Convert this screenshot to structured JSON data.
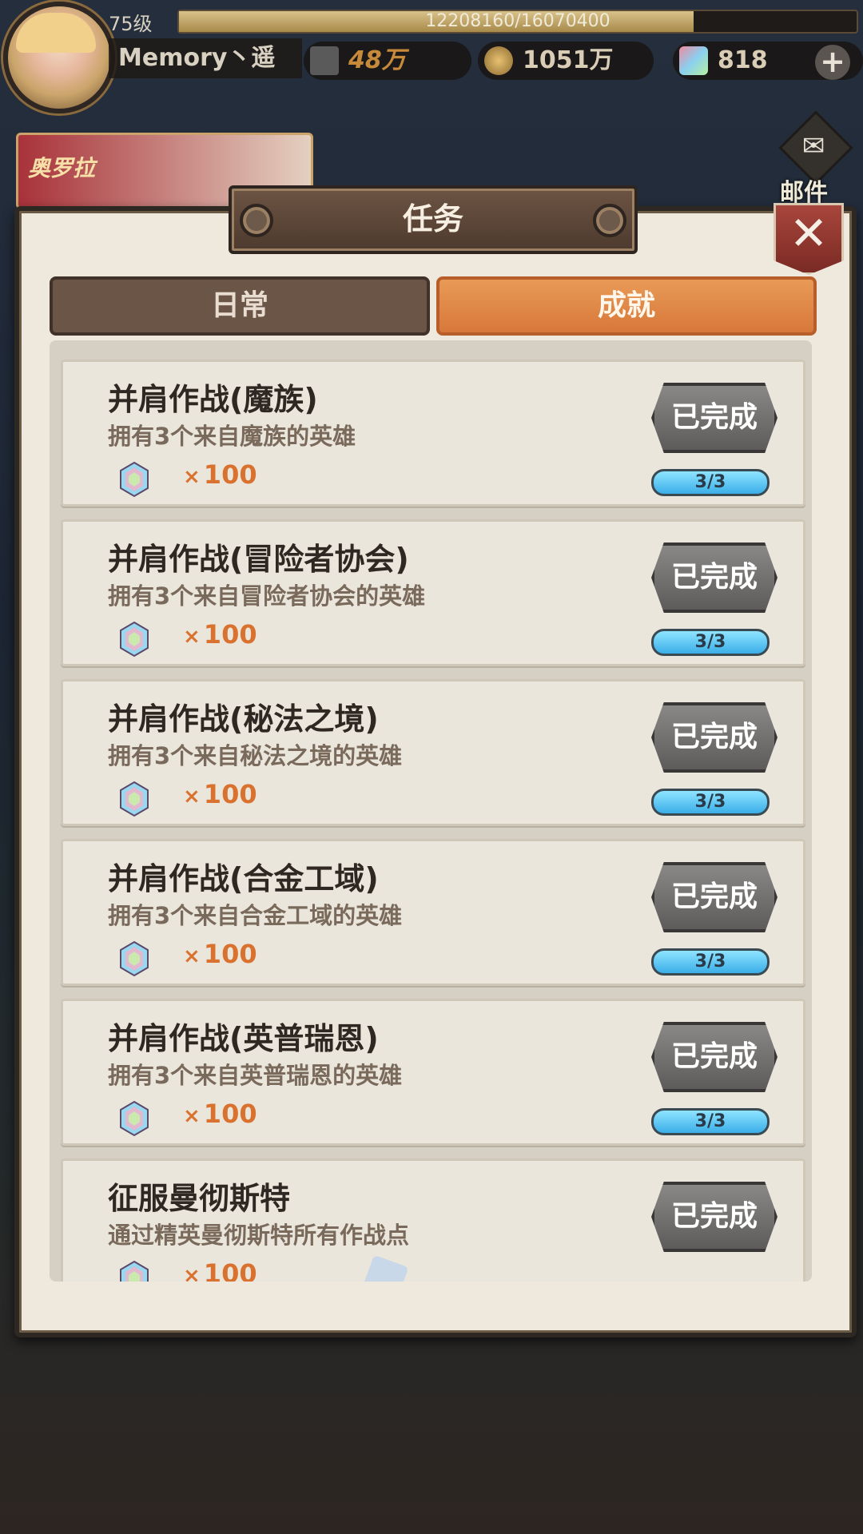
{
  "hud": {
    "level": "75级",
    "exp_text": "12208160/16070400",
    "exp_progress": 0.76,
    "player_name": "Memory丶遥",
    "power": "48万",
    "gold": "1051万",
    "gems": "818",
    "plus": "+"
  },
  "mail": {
    "label": "邮件",
    "icon": "envelope-icon"
  },
  "event_banner": {
    "label": "奥罗拉"
  },
  "dialog": {
    "title": "任务",
    "close": "✕",
    "tabs": [
      {
        "label": "日常",
        "active": false
      },
      {
        "label": "成就",
        "active": true
      }
    ]
  },
  "tasks": [
    {
      "name": "并肩作战(魔族)",
      "desc": "拥有3个来自魔族的英雄",
      "reward_x": "×",
      "reward": "100",
      "status": "已完成",
      "progress": "3/3"
    },
    {
      "name": "并肩作战(冒险者协会)",
      "desc": "拥有3个来自冒险者协会的英雄",
      "reward_x": "×",
      "reward": "100",
      "status": "已完成",
      "progress": "3/3"
    },
    {
      "name": "并肩作战(秘法之境)",
      "desc": "拥有3个来自秘法之境的英雄",
      "reward_x": "×",
      "reward": "100",
      "status": "已完成",
      "progress": "3/3"
    },
    {
      "name": "并肩作战(合金工域)",
      "desc": "拥有3个来自合金工域的英雄",
      "reward_x": "×",
      "reward": "100",
      "status": "已完成",
      "progress": "3/3"
    },
    {
      "name": "并肩作战(英普瑞恩)",
      "desc": "拥有3个来自英普瑞恩的英雄",
      "reward_x": "×",
      "reward": "100",
      "status": "已完成",
      "progress": "3/3"
    },
    {
      "name": "征服曼彻斯特",
      "desc": "通过精英曼彻斯特所有作战点",
      "reward_x": "×",
      "reward": "100",
      "status": "已完成",
      "progress": ""
    }
  ]
}
